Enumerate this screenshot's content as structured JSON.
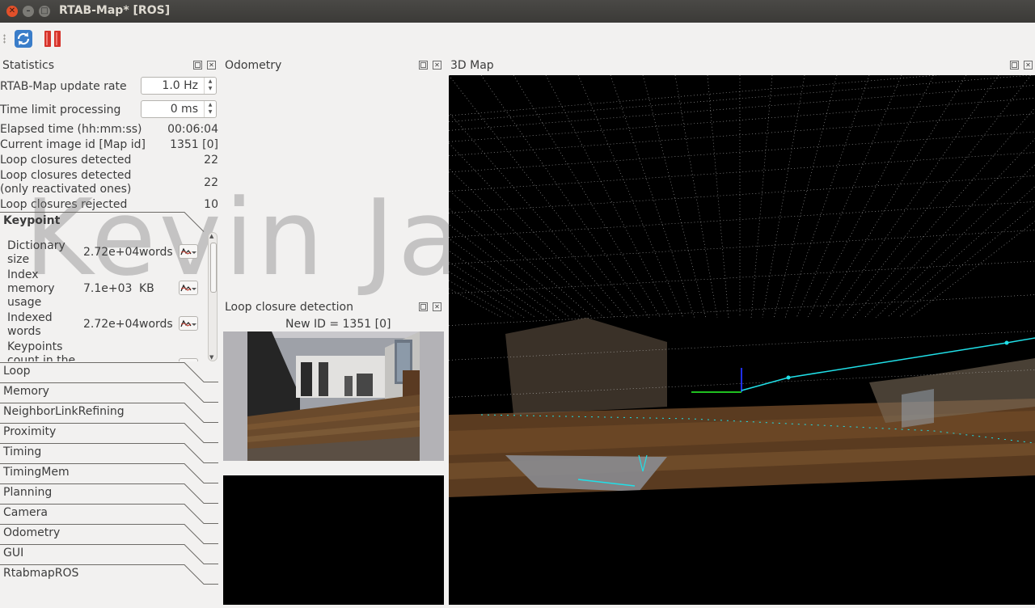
{
  "window": {
    "title": "RTAB-Map* [ROS]"
  },
  "toolbar": {
    "refresh_icon": "refresh-icon",
    "pause_icon": "pause-icon"
  },
  "docks": {
    "statistics": "Statistics",
    "odometry": "Odometry",
    "map3d": "3D Map",
    "loop_closure": "Loop closure detection"
  },
  "statistics": {
    "update_rate_label": "RTAB-Map update rate",
    "update_rate_value": "1.0 Hz",
    "time_limit_label": "Time limit processing",
    "time_limit_value": "0 ms",
    "rows": [
      {
        "label": "Elapsed time (hh:mm:ss)",
        "value": "00:06:04"
      },
      {
        "label": "Current image id [Map id]",
        "value": "1351 [0]"
      },
      {
        "label": "Loop closures detected",
        "value": "22"
      },
      {
        "label": "Loop closures detected",
        "label2": "(only reactivated ones)",
        "value": "22"
      },
      {
        "label": "Loop closures rejected",
        "value": "10"
      }
    ]
  },
  "keypoint": {
    "header": "Keypoint",
    "items": [
      {
        "name_l1": "Dictionary",
        "name_l2": "size",
        "name_l3": "",
        "value": "2.72e+04",
        "unit": "words"
      },
      {
        "name_l1": "Index",
        "name_l2": "memory",
        "name_l3": "usage",
        "value": "7.1e+03",
        "unit": "KB"
      },
      {
        "name_l1": "Indexed",
        "name_l2": "words",
        "name_l3": "",
        "value": "2.72e+04",
        "unit": "words"
      },
      {
        "name_l1": "Keypoints",
        "name_l2": "count in the",
        "name_l3": "",
        "value": "",
        "unit": ""
      }
    ]
  },
  "tabs": [
    "Loop",
    "Memory",
    "NeighborLinkRefining",
    "Proximity",
    "Timing",
    "TimingMem",
    "Planning",
    "Camera",
    "Odometry",
    "GUI",
    "RtabmapROS"
  ],
  "loop_closure": {
    "new_id": "New ID = 1351 [0]"
  },
  "watermark": "Kevin Ja"
}
